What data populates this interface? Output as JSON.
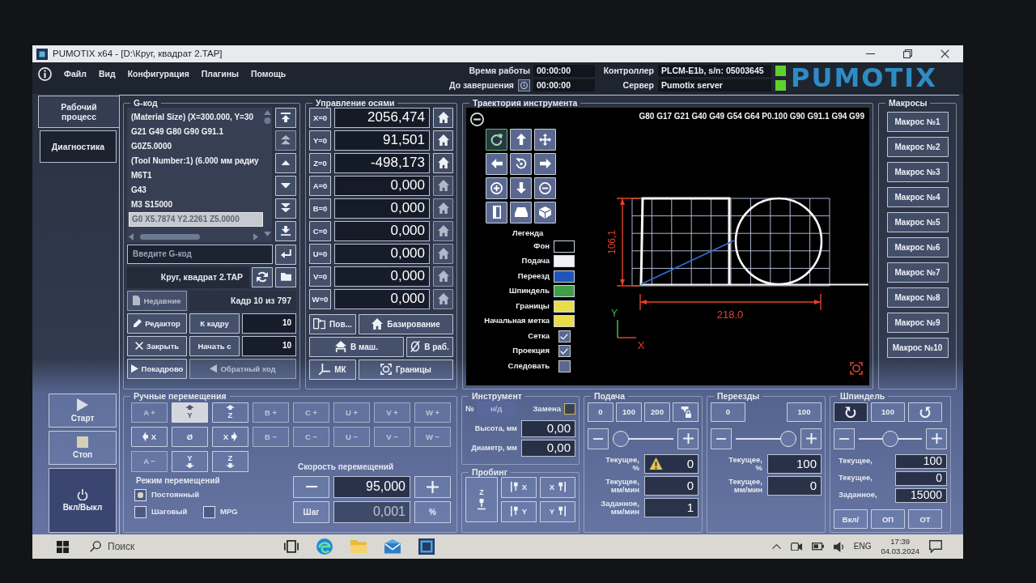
{
  "window": {
    "title": "PUMOTIX x64 - [D:\\Круг, квадрат 2.TAP]"
  },
  "menu": [
    "Файл",
    "Вид",
    "Конфигурация",
    "Плагины",
    "Помощь"
  ],
  "timers": [
    {
      "kind": "plain",
      "label": "Время работы",
      "value": "00:00:00"
    },
    {
      "kind": "clock",
      "label": "До завершения",
      "value": "00:00:00"
    }
  ],
  "connections": [
    {
      "label": "Контроллер",
      "value": "PLCM-E1b, s/n: 05003645",
      "connected": true
    },
    {
      "label": "Сервер",
      "value": "Pumotix server",
      "connected": true
    }
  ],
  "logo": "PUMOTIX",
  "nav": {
    "tabs": [
      {
        "label": "Рабочий процесс",
        "selected": true
      },
      {
        "label": "Диагностика",
        "selected": false
      }
    ],
    "actions": [
      {
        "kind": "start",
        "label": "Старт"
      },
      {
        "kind": "stop",
        "label": "Стоп"
      },
      {
        "kind": "power",
        "label": "Вкл/Выкл"
      }
    ]
  },
  "gcode": {
    "title": "G-код",
    "lines": [
      {
        "text": "(Material Size) (X=300.000, Y=30",
        "selected": false
      },
      {
        "text": "G21 G49 G80 G90 G91.1",
        "selected": false
      },
      {
        "text": "G0Z5.0000",
        "selected": false
      },
      {
        "text": "(Tool Number:1) (6.000 мм радиу",
        "selected": false
      },
      {
        "text": "M6T1",
        "selected": false
      },
      {
        "text": "G43",
        "selected": false
      },
      {
        "text": "M3 S15000",
        "selected": false
      },
      {
        "text": "G0 X5.7874 Y2.2261 Z5.0000",
        "selected": true
      }
    ],
    "nav_buttons": [
      {
        "kind": "first",
        "disabled": false
      },
      {
        "kind": "page-up",
        "disabled": true
      },
      {
        "kind": "up",
        "disabled": false
      },
      {
        "kind": "down",
        "disabled": false
      },
      {
        "kind": "page-down",
        "disabled": false
      },
      {
        "kind": "last",
        "disabled": false
      }
    ],
    "input": {
      "placeholder": "Введите G-код"
    },
    "file": "Круг, квадрат 2.TAP",
    "recent": {
      "label": "Недавние",
      "disabled": true
    },
    "frame": "Кадр 10 из 797",
    "editor": "Редактор",
    "goto": {
      "label": "К кадру",
      "value": "10"
    },
    "close": "Закрыть",
    "start_from": {
      "label": "Начать с",
      "value": "10"
    },
    "single_block": "Покадрово",
    "reverse": {
      "label": "Обратный ход",
      "disabled": true
    }
  },
  "axes": {
    "title": "Управление осями",
    "rows": [
      {
        "label": "X=0",
        "value": "2056,474",
        "disabled": false
      },
      {
        "label": "Y=0",
        "value": "91,501",
        "disabled": false
      },
      {
        "label": "Z=0",
        "value": "-498,173",
        "disabled": false
      },
      {
        "label": "A=0",
        "value": "0,000",
        "disabled": true
      },
      {
        "label": "B=0",
        "value": "0,000",
        "disabled": true
      },
      {
        "label": "C=0",
        "value": "0,000",
        "disabled": true
      },
      {
        "label": "U=0",
        "value": "0,000",
        "disabled": true
      },
      {
        "label": "V=0",
        "value": "0,000",
        "disabled": true
      },
      {
        "label": "W=0",
        "value": "0,000",
        "disabled": true
      }
    ],
    "actions": [
      {
        "kind": "rotate",
        "label": "Пов..."
      },
      {
        "kind": "home",
        "label": "Базирование"
      },
      {
        "kind": "machine",
        "label": "В маш."
      },
      {
        "kind": "zero",
        "label": "В раб."
      },
      {
        "kind": "axes",
        "label": "МК"
      },
      {
        "kind": "limits",
        "label": "Границы"
      }
    ]
  },
  "trajectory": {
    "title": "Траектория инструмента",
    "modal": "G80 G17 G21 G40 G49 G54 G64 P0.100 G90 G91.1 G94 G99",
    "view_buttons": [
      {
        "kind": "rotate",
        "selected": true
      },
      {
        "kind": "up",
        "selected": false
      },
      {
        "kind": "pan",
        "selected": false
      },
      {
        "kind": "left",
        "selected": false
      },
      {
        "kind": "reset",
        "selected": false
      },
      {
        "kind": "right",
        "selected": false
      },
      {
        "kind": "zoom-in",
        "selected": false
      },
      {
        "kind": "down",
        "selected": false
      },
      {
        "kind": "zoom-out",
        "selected": false
      },
      {
        "kind": "side",
        "selected": false
      },
      {
        "kind": "front",
        "selected": false
      },
      {
        "kind": "iso",
        "selected": false
      }
    ],
    "legend": {
      "title": "Легенда",
      "items": [
        {
          "label": "Фон",
          "color": "#000000"
        },
        {
          "label": "Подача",
          "color": "#f2f2f2"
        },
        {
          "label": "Переезд",
          "color": "#1f55b8"
        },
        {
          "label": "Шпиндель",
          "color": "#3f9e48"
        },
        {
          "label": "Границы",
          "color": "#e9dc48"
        },
        {
          "label": "Начальная метка",
          "color": "#e9dc48"
        }
      ],
      "options": [
        {
          "label": "Сетка",
          "checked": true
        },
        {
          "label": "Проекция",
          "checked": true
        },
        {
          "label": "Следовать",
          "checked": false
        }
      ]
    },
    "height_dim": "106,1",
    "width_dim": "218.0",
    "axis_y": "Y",
    "axis_x": "X"
  },
  "macros": {
    "title": "Макросы",
    "items": [
      "Макрос №1",
      "Макрос №2",
      "Макрос №3",
      "Макрос №4",
      "Макрос №5",
      "Макрос №6",
      "Макрос №7",
      "Макрос №8",
      "Макрос №9",
      "Макрос №10"
    ]
  },
  "jog": {
    "title": "Ручные перемещения",
    "buttons": [
      {
        "label": "A +",
        "kind": "plain",
        "disabled": true,
        "selected": false
      },
      {
        "label": "Y",
        "kind": "up",
        "disabled": false,
        "selected": true
      },
      {
        "label": "Z",
        "kind": "up",
        "disabled": false,
        "selected": false
      },
      {
        "label": "B +",
        "kind": "plain",
        "disabled": true,
        "selected": false
      },
      {
        "label": "C +",
        "kind": "plain",
        "disabled": true,
        "selected": false
      },
      {
        "label": "U +",
        "kind": "plain",
        "disabled": true,
        "selected": false
      },
      {
        "label": "V +",
        "kind": "plain",
        "disabled": true,
        "selected": false
      },
      {
        "label": "W +",
        "kind": "plain",
        "disabled": true,
        "selected": false
      },
      {
        "label": "X",
        "kind": "left",
        "disabled": false,
        "selected": false
      },
      {
        "label": "Ø",
        "kind": "plain",
        "disabled": false,
        "selected": false
      },
      {
        "label": "X",
        "kind": "right",
        "disabled": false,
        "selected": false
      },
      {
        "label": "B −",
        "kind": "plain",
        "disabled": true,
        "selected": false
      },
      {
        "label": "C −",
        "kind": "plain",
        "disabled": true,
        "selected": false
      },
      {
        "label": "U −",
        "kind": "plain",
        "disabled": true,
        "selected": false
      },
      {
        "label": "V −",
        "kind": "plain",
        "disabled": true,
        "selected": false
      },
      {
        "label": "W −",
        "kind": "plain",
        "disabled": true,
        "selected": false
      },
      {
        "label": "A −",
        "kind": "plain",
        "disabled": true,
        "selected": false
      },
      {
        "label": "Y",
        "kind": "down",
        "disabled": false,
        "selected": false
      },
      {
        "label": "Z",
        "kind": "down",
        "disabled": false,
        "selected": false
      }
    ],
    "mode": {
      "title": "Режим перемещений",
      "options": [
        {
          "label": "Постоянный",
          "checked": true
        },
        {
          "label": "Шаговый",
          "checked": false
        },
        {
          "label": "MPG",
          "checked": false
        }
      ]
    },
    "speed": {
      "title": "Скорость перемещений",
      "value": "95,000",
      "step_label": "Шаг",
      "step": {
        "value": "0,001",
        "disabled": true
      },
      "percent": "%"
    }
  },
  "tool": {
    "title": "Инструмент",
    "number_label": "№",
    "number": "н/д",
    "change": {
      "label": "Замена",
      "checked": false
    },
    "fields": [
      {
        "label": "Высота, мм",
        "value": "0,00"
      },
      {
        "label": "Диаметр, мм",
        "value": "0,00"
      }
    ]
  },
  "probing": {
    "title": "Пробинг",
    "buttons": [
      {
        "kind": "z",
        "label": "Z"
      },
      {
        "kind": "minus",
        "label": "X"
      },
      {
        "kind": "plus",
        "label": "X"
      },
      {
        "kind": "minus",
        "label": "Y"
      },
      {
        "kind": "plus",
        "label": "Y"
      }
    ]
  },
  "feed": {
    "title": "Подача",
    "presets": [
      "0",
      "100",
      "200"
    ],
    "level": 0,
    "readings": [
      {
        "label": "Текущее, %",
        "value": "0",
        "warning": true
      },
      {
        "label": "Текущее, мм/мин",
        "value": "0",
        "warning": false
      },
      {
        "label": "Заданное, мм/мин",
        "value": "1",
        "warning": false
      }
    ]
  },
  "rapid": {
    "title": "Переезды",
    "presets": [
      "0",
      "100"
    ],
    "level": 1,
    "readings": [
      {
        "label": "Текущее, %",
        "value": "100",
        "warning": false
      },
      {
        "label": "Текущее, мм/мин",
        "value": "0",
        "warning": false
      }
    ]
  },
  "spindle": {
    "title": "Шпиндель",
    "directions": [
      {
        "kind": "cw",
        "selected": true
      },
      {
        "kind": "ccw",
        "selected": false
      }
    ],
    "preset": "100",
    "level": 0.5,
    "readings": [
      {
        "label": "Текущее,",
        "value": "100"
      },
      {
        "label": "Текущее,",
        "value": "0"
      },
      {
        "label": "Заданное,",
        "value": "15000"
      }
    ],
    "buttons": [
      "Вкл/",
      "ОП",
      "ОТ"
    ]
  },
  "taskbar": {
    "search": {
      "placeholder": "Поиск"
    },
    "language": "ENG",
    "time": "17:39",
    "date": "04.03.2024"
  }
}
